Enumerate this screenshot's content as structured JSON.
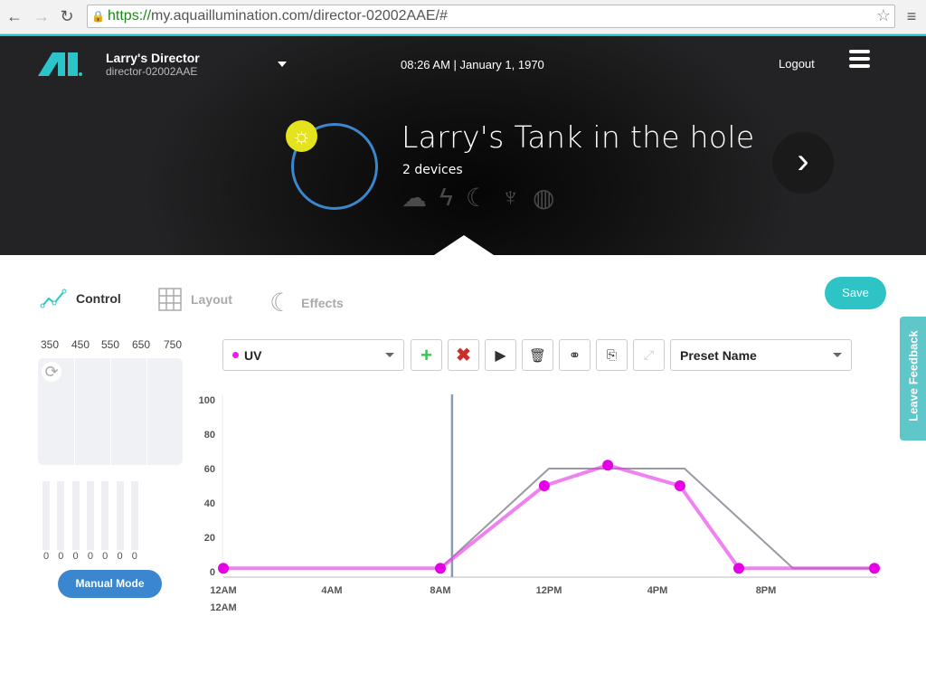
{
  "browser": {
    "url_https": "https://",
    "url_rest": "my.aquaillumination.com/director-02002AAE/#"
  },
  "header": {
    "device_name": "Larry's Director",
    "device_id": "director-02002AAE",
    "time": "08:26 AM |",
    "date": "January 1, 1970",
    "logout": "Logout"
  },
  "tank": {
    "title": "Larry's Tank in the hole",
    "devices": "2 devices",
    "icons": [
      "cloud-icon",
      "lightning-icon",
      "moon-icon",
      "coral-icon",
      "globe-icon"
    ]
  },
  "tabs": [
    {
      "label": "Control",
      "active": true
    },
    {
      "label": "Layout",
      "active": false
    },
    {
      "label": "Effects",
      "active": false
    }
  ],
  "save_label": "Save",
  "spectrum": {
    "wavelengths": [
      "350",
      "450",
      "550",
      "650",
      "750"
    ],
    "channel_values": [
      "0",
      "0",
      "0",
      "0",
      "0",
      "0",
      "0"
    ]
  },
  "manual_mode": "Manual Mode",
  "toolbar": {
    "channel": "UV",
    "channel_color": "#e81ee8",
    "preset": "Preset Name"
  },
  "feedback": "Leave Feedback",
  "chart_data": {
    "type": "line",
    "ylim": [
      0,
      100
    ],
    "yticks": [
      "0",
      "20",
      "40",
      "60",
      "80",
      "100"
    ],
    "xlim": [
      0,
      24
    ],
    "xticks": [
      {
        "h": 0,
        "label": "12AM"
      },
      {
        "h": 4,
        "label": "4AM"
      },
      {
        "h": 8,
        "label": "8AM"
      },
      {
        "h": 12,
        "label": "12PM"
      },
      {
        "h": 16,
        "label": "4PM"
      },
      {
        "h": 20,
        "label": "8PM"
      }
    ],
    "xlabel_extra": "12AM",
    "current_time_h": 8.43,
    "series": [
      {
        "color": "#e83ee8",
        "points": [
          [
            0,
            2
          ],
          [
            8,
            2
          ],
          [
            11.83,
            50
          ],
          [
            14.17,
            62
          ],
          [
            16.83,
            50
          ],
          [
            19,
            2
          ],
          [
            24,
            2
          ]
        ]
      },
      {
        "color": "#9a9aa6",
        "points": [
          [
            8,
            2
          ],
          [
            12,
            60
          ],
          [
            17,
            60
          ],
          [
            21,
            2
          ],
          [
            24,
            2
          ]
        ]
      }
    ]
  }
}
